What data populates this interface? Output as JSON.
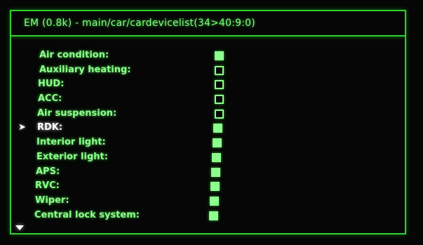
{
  "header": {
    "title": "EM (0.8k) - main/car/cardevicelist(34>40:9:0)"
  },
  "menu": {
    "selected_marker": "➤",
    "items": [
      {
        "label": "Air condition:",
        "checked": true
      },
      {
        "label": "Auxiliary heating:",
        "checked": false
      },
      {
        "label": "HUD:",
        "checked": false
      },
      {
        "label": "ACC:",
        "checked": false
      },
      {
        "label": "Air suspension:",
        "checked": false
      },
      {
        "label": "RDK:",
        "checked": true,
        "selected": true
      },
      {
        "label": "Interior light:",
        "checked": true
      },
      {
        "label": "Exterior light:",
        "checked": true
      },
      {
        "label": "APS:",
        "checked": true
      },
      {
        "label": "RVC:",
        "checked": true
      },
      {
        "label": "Wiper:",
        "checked": true
      },
      {
        "label": "Central lock system:",
        "checked": true
      }
    ]
  },
  "colors": {
    "screen_bg": "#050605",
    "accent_green": "#2fd02f",
    "text_green": "#8dff8d",
    "selected_text": "#ffffff"
  },
  "icons": {
    "selection": "selection-arrow-icon",
    "scroll": "scroll-down-arrow-icon"
  }
}
